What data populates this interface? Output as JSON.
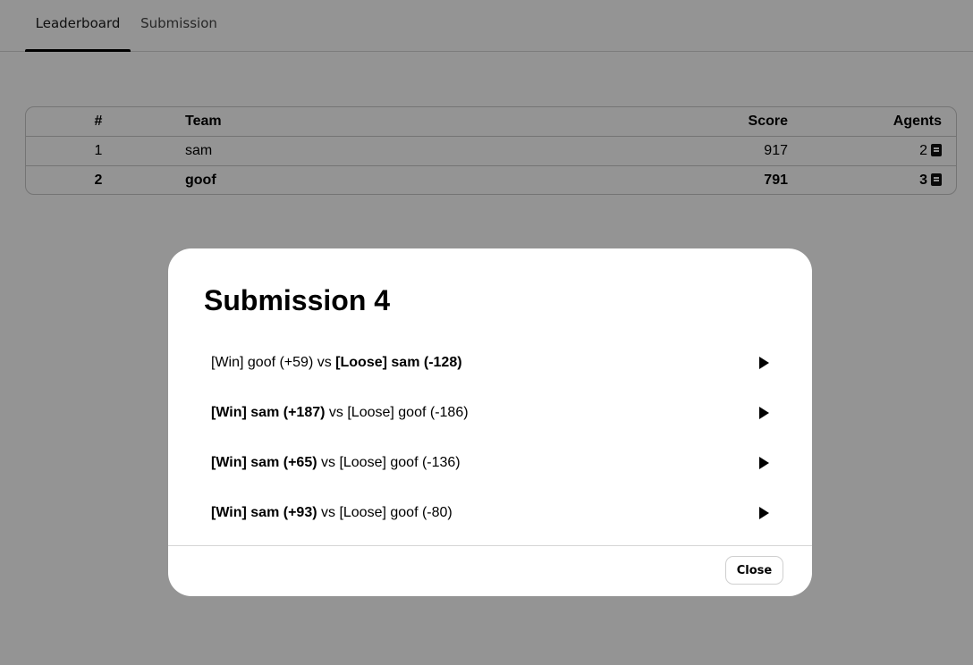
{
  "tabs": [
    {
      "label": "Leaderboard",
      "active": true
    },
    {
      "label": "Submission",
      "active": false
    }
  ],
  "leaderboard": {
    "headers": {
      "rank": "#",
      "team": "Team",
      "score": "Score",
      "agents": "Agents"
    },
    "rows": [
      {
        "rank": "1",
        "team": "sam",
        "score": "917",
        "agents": "2",
        "highlight": false
      },
      {
        "rank": "2",
        "team": "goof",
        "score": "791",
        "agents": "3",
        "highlight": true
      }
    ]
  },
  "modal": {
    "title": "Submission 4",
    "matches": [
      {
        "left": "[Win] goof (+59)",
        "left_bold": false,
        "vs": " vs ",
        "right": "[Loose] sam (-128)",
        "right_bold": true
      },
      {
        "left": "[Win] sam (+187)",
        "left_bold": true,
        "vs": " vs ",
        "right": "[Loose] goof (-186)",
        "right_bold": false
      },
      {
        "left": "[Win] sam (+65)",
        "left_bold": true,
        "vs": " vs ",
        "right": "[Loose] goof (-136)",
        "right_bold": false
      },
      {
        "left": "[Win] sam (+93)",
        "left_bold": true,
        "vs": " vs ",
        "right": "[Loose] goof (-80)",
        "right_bold": false
      }
    ],
    "close_label": "Close"
  },
  "icons": {
    "agents": "book-icon",
    "play": "play-icon"
  },
  "colors": {
    "overlay": "rgba(0,0,0,0.42)",
    "border": "#c8c8c8"
  }
}
